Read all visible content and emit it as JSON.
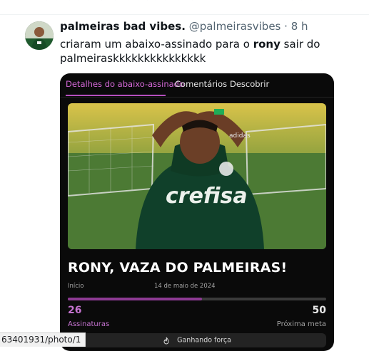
{
  "top_strip": {
    "left_text": "~~ ~~~ ~ ~ ~~~~~ ~ ~",
    "right_text": "~~~"
  },
  "tweet": {
    "display_name": "palmeiras bad vibes.",
    "handle": "@palmeirasvibes",
    "separator": "·",
    "time": "8 h",
    "text_before": "criaram um abaixo-assinado para o ",
    "text_bold": "rony",
    "text_after": " sair do palmeiraskkkkkkkkkkkkkkk"
  },
  "card": {
    "tabs": [
      {
        "label": "Detalhes do abaixo-assinado",
        "active": true
      },
      {
        "label": "Comentários",
        "active": false
      },
      {
        "label": "Descobrir",
        "active": false
      }
    ],
    "photo": {
      "shirt_text": "crefisa",
      "sleeve_text": "adidas"
    },
    "headline": "RONY, VAZA DO PALMEIRAS!",
    "start_label": "Início",
    "start_date": "14 de maio de 2024",
    "progress_fraction": 0.52,
    "signatures_count": "26",
    "signatures_label": "Assinaturas",
    "goal_count": "50",
    "goal_label": "Próxima meta",
    "status_text": "Ganhando força",
    "colors": {
      "accent": "#c573d0",
      "background": "#0a0a0a"
    }
  },
  "url_tooltip": "63401931/photo/1"
}
